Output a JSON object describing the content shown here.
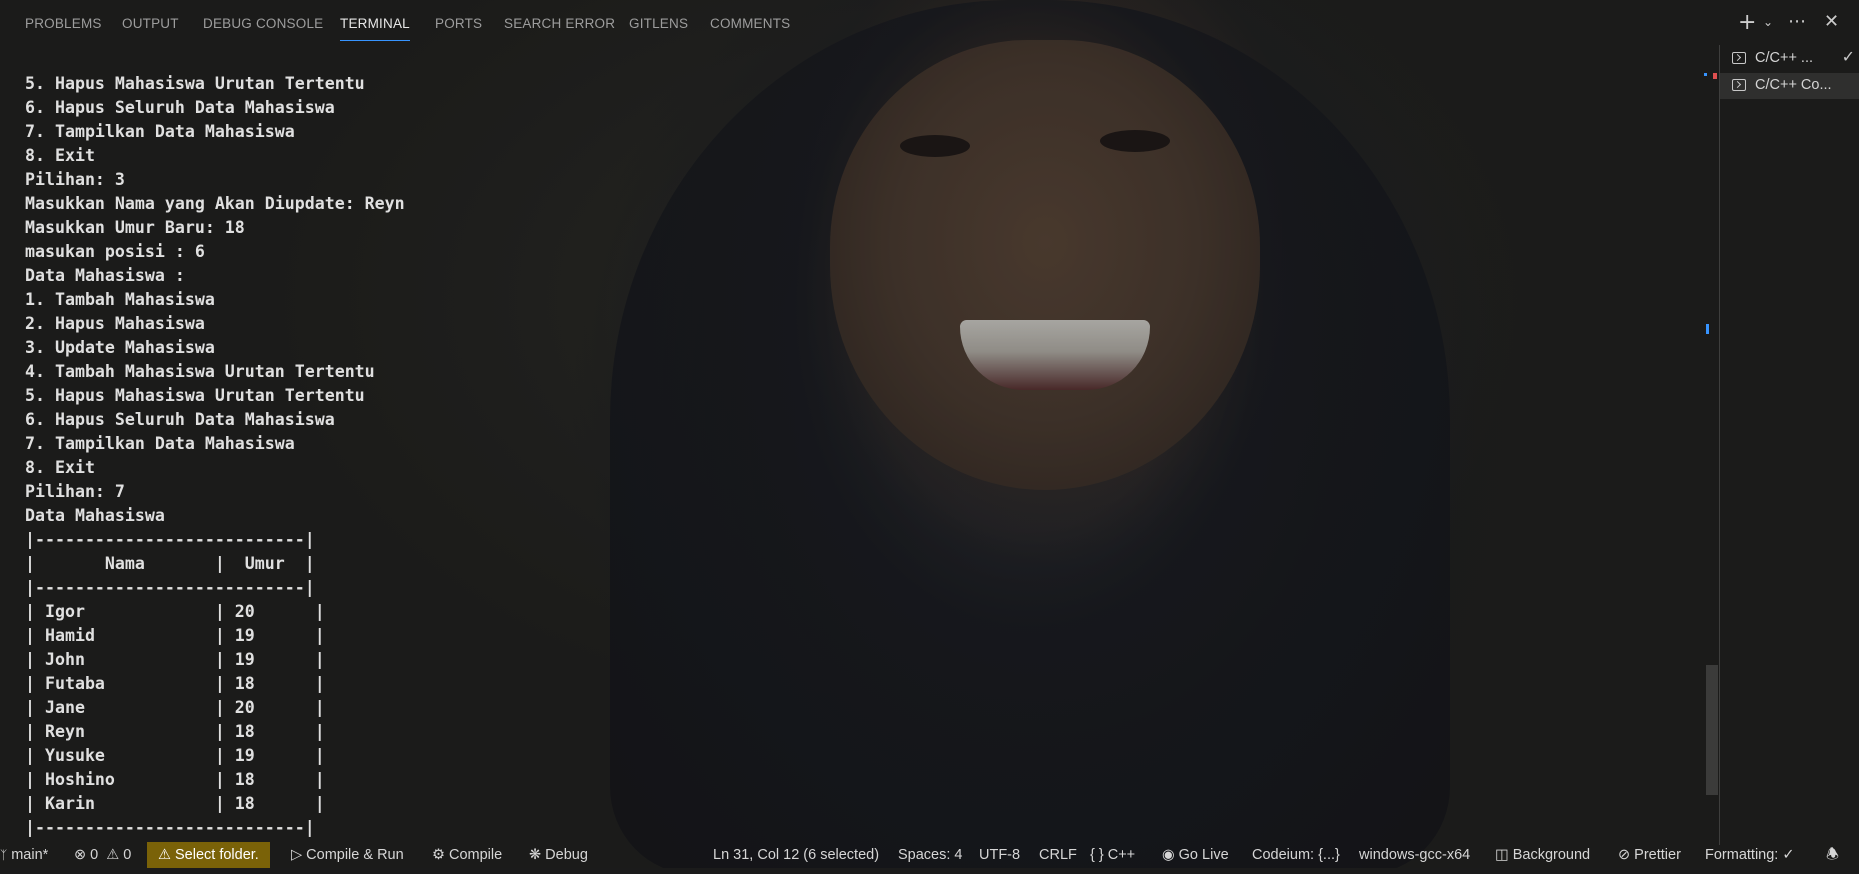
{
  "colors": {
    "accent": "#3794ff",
    "warning_background": "#7a6208",
    "terminal_text": "#e0e0e0"
  },
  "panel": {
    "tabs": [
      {
        "label": "PROBLEMS"
      },
      {
        "label": "OUTPUT"
      },
      {
        "label": "DEBUG CONSOLE"
      },
      {
        "label": "TERMINAL",
        "active": true
      },
      {
        "label": "PORTS"
      },
      {
        "label": "SEARCH ERROR"
      },
      {
        "label": "GITLENS"
      },
      {
        "label": "COMMENTS"
      }
    ],
    "actions": {
      "new_terminal_icon": "plus-icon",
      "dropdown_icon": "chevron-down-icon",
      "more_icon": "ellipsis-icon",
      "close_icon": "close-icon"
    }
  },
  "terminal": {
    "lines": [
      "5. Hapus Mahasiswa Urutan Tertentu",
      "6. Hapus Seluruh Data Mahasiswa",
      "7. Tampilkan Data Mahasiswa",
      "8. Exit",
      "Pilihan: 3",
      "Masukkan Nama yang Akan Diupdate: Reyn",
      "Masukkan Umur Baru: 18",
      "masukan posisi : 6",
      "Data Mahasiswa :",
      "1. Tambah Mahasiswa",
      "2. Hapus Mahasiswa",
      "3. Update Mahasiswa",
      "4. Tambah Mahasiswa Urutan Tertentu",
      "5. Hapus Mahasiswa Urutan Tertentu",
      "6. Hapus Seluruh Data Mahasiswa",
      "7. Tampilkan Data Mahasiswa",
      "8. Exit",
      "Pilihan: 7",
      "Data Mahasiswa",
      "|---------------------------|",
      "|       Nama       |  Umur  |",
      "|---------------------------|",
      "| Igor             | 20      |",
      "| Hamid            | 19      |",
      "| John             | 19      |",
      "| Futaba           | 18      |",
      "| Jane             | 20      |",
      "| Reyn             | 18      |",
      "| Yusuke           | 19      |",
      "| Hoshino          | 18      |",
      "| Karin            | 18      |",
      "|---------------------------|"
    ]
  },
  "terminal_list": [
    {
      "label": "C/C++ ...",
      "icon": "terminal-icon",
      "status_icon": "check-icon"
    },
    {
      "label": "C/C++ Co...",
      "icon": "terminal-icon",
      "selected": true
    }
  ],
  "status_bar": {
    "branch": "main*",
    "branch_icon": "git-branch-icon",
    "errors": "0",
    "warnings": "0",
    "select_folder": "Select folder.",
    "compile_run": "Compile & Run",
    "compile": "Compile",
    "debug": "Debug",
    "cursor_position": "Ln 31, Col 12 (6 selected)",
    "spaces": "Spaces: 4",
    "encoding": "UTF-8",
    "eol": "CRLF",
    "language": "C++",
    "go_live": "Go Live",
    "codeium": "Codeium: {...}",
    "compiler": "windows-gcc-x64",
    "background": "Background",
    "prettier": "Prettier",
    "formatting": "Formatting: ✓"
  }
}
